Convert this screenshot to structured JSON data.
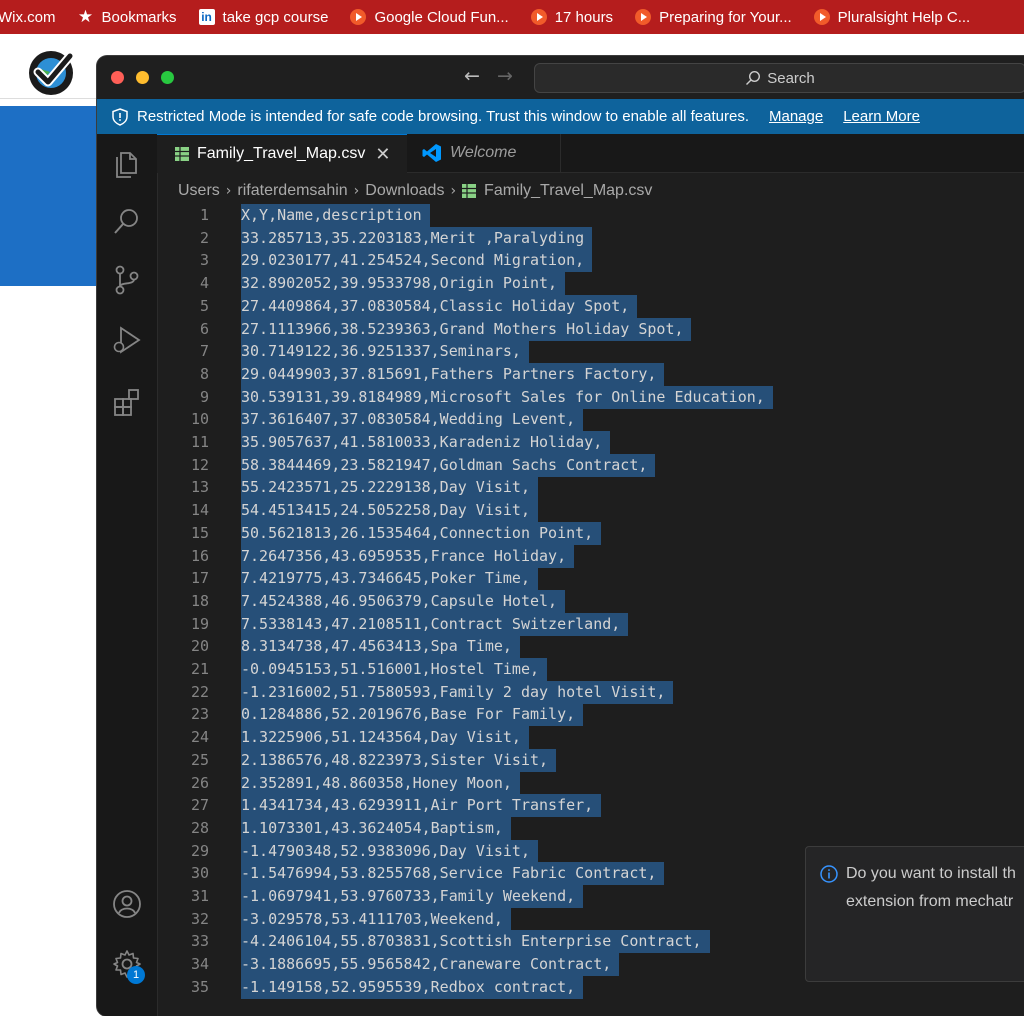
{
  "bookmarks": [
    {
      "label": "Wix.com",
      "icon": "none"
    },
    {
      "label": "Bookmarks",
      "icon": "star-icon"
    },
    {
      "label": "take gcp course",
      "icon": "linkedin-icon"
    },
    {
      "label": "Google Cloud Fun...",
      "icon": "pluralsight-icon"
    },
    {
      "label": "17 hours",
      "icon": "pluralsight-icon"
    },
    {
      "label": "Preparing for Your...",
      "icon": "pluralsight-icon"
    },
    {
      "label": "Pluralsight Help C...",
      "icon": "pluralsight-icon"
    }
  ],
  "window": {
    "search_label": "Search",
    "restricted_message": "Restricted Mode is intended for safe code browsing. Trust this window to enable all features.",
    "manage_label": "Manage",
    "learn_more_label": "Learn More"
  },
  "tabs": [
    {
      "label": "Family_Travel_Map.csv",
      "active": true
    },
    {
      "label": "Welcome",
      "active": false
    }
  ],
  "breadcrumb": [
    "Users",
    "rifaterdemsahin",
    "Downloads",
    "Family_Travel_Map.csv"
  ],
  "activity_bar": {
    "icons": [
      "files-icon",
      "search-icon",
      "source-control-icon",
      "run-debug-icon",
      "extensions-icon",
      "account-icon",
      "settings-gear-icon"
    ],
    "settings_badge": "1"
  },
  "editor": {
    "lines": [
      "X,Y,Name,description",
      "33.285713,35.2203183,Merit ,Paralyding",
      "29.0230177,41.254524,Second Migration,",
      "32.8902052,39.9533798,Origin Point,",
      "27.4409864,37.0830584,Classic Holiday Spot,",
      "27.1113966,38.5239363,Grand Mothers Holiday Spot,",
      "30.7149122,36.9251337,Seminars,",
      "29.0449903,37.815691,Fathers Partners Factory,",
      "30.539131,39.8184989,Microsoft Sales for Online Education,",
      "37.3616407,37.0830584,Wedding Levent,",
      "35.9057637,41.5810033,Karadeniz Holiday,",
      "58.3844469,23.5821947,Goldman Sachs Contract,",
      "55.2423571,25.2229138,Day Visit,",
      "54.4513415,24.5052258,Day Visit,",
      "50.5621813,26.1535464,Connection Point,",
      "7.2647356,43.6959535,France Holiday,",
      "7.4219775,43.7346645,Poker Time,",
      "7.4524388,46.9506379,Capsule Hotel,",
      "7.5338143,47.2108511,Contract Switzerland,",
      "8.3134738,47.4563413,Spa Time,",
      "-0.0945153,51.516001,Hostel Time,",
      "-1.2316002,51.7580593,Family 2 day hotel Visit,",
      "0.1284886,52.2019676,Base For Family,",
      "1.3225906,51.1243564,Day Visit,",
      "2.1386576,48.8223973,Sister Visit,",
      "2.352891,48.860358,Honey Moon,",
      "1.4341734,43.6293911,Air Port Transfer,",
      "1.1073301,43.3624054,Baptism,",
      "-1.4790348,52.9383096,Day Visit,",
      "-1.5476994,53.8255768,Service Fabric Contract,",
      "-1.0697941,53.9760733,Family Weekend,",
      "-3.029578,53.4111703,Weekend,",
      "-4.2406104,55.8703831,Scottish Enterprise Contract,",
      "-3.1886695,55.9565842,Craneware Contract,",
      "-1.149158,52.9595539,Redbox contract,"
    ]
  },
  "notification": {
    "line1": "Do you want to install th",
    "line2": "extension from mechatr"
  },
  "colors": {
    "bookmarks_bar": "#b51d1d",
    "restricted_banner": "#0e639c",
    "selection": "#264f78",
    "editor_bg": "#1e1e1e"
  }
}
